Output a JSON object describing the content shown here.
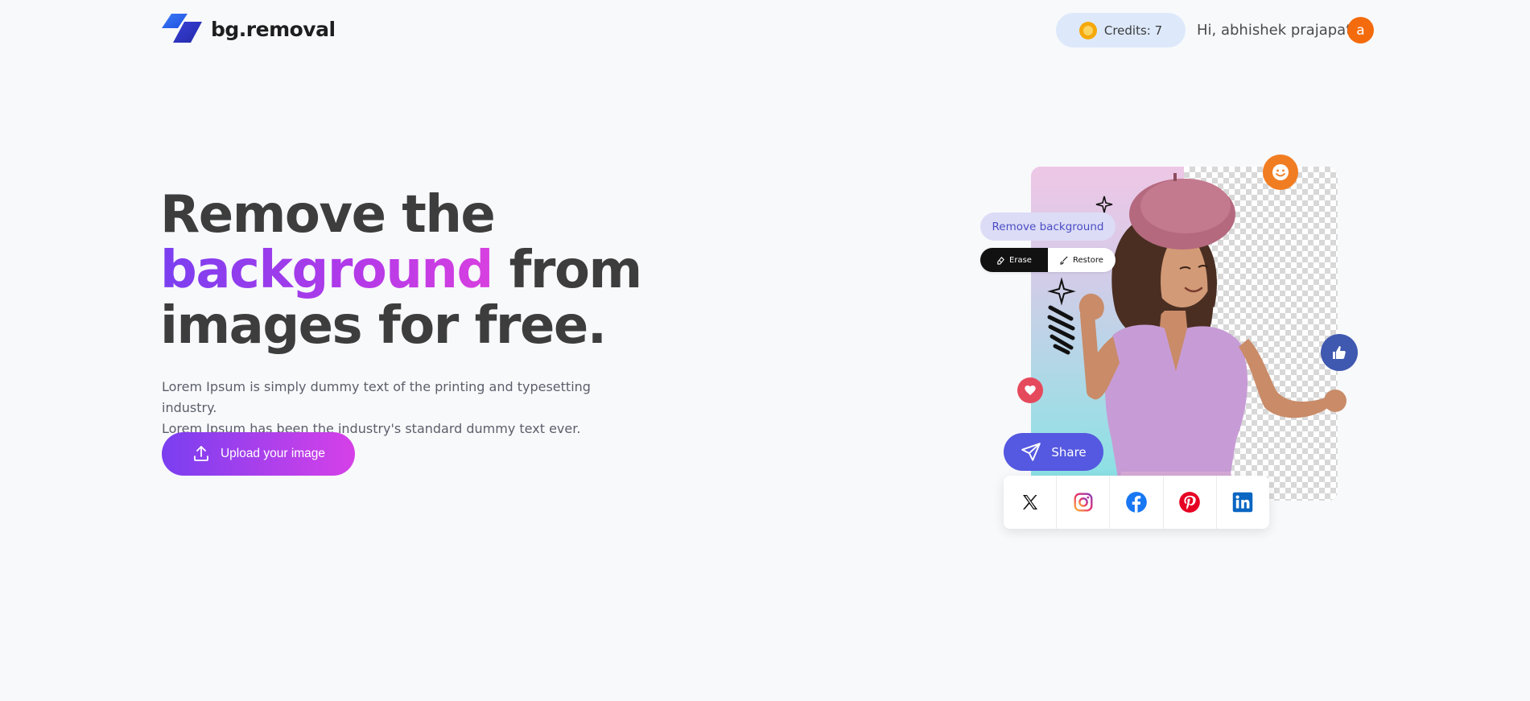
{
  "nav": {
    "brand": "bg.removal",
    "credits_label": "Credits: 7",
    "greeting": "Hi, abhishek prajapati",
    "avatar_initial": "a"
  },
  "hero": {
    "headline_line1": "Remove the",
    "headline_highlight": "background",
    "headline_line2_rest": " from",
    "headline_line3": "images for free.",
    "description_line1": "Lorem Ipsum is simply dummy text of the printing and typesetting industry.",
    "description_line2": "Lorem Ipsum has been the industry's standard dummy text ever.",
    "upload_label": "Upload your image"
  },
  "illustration": {
    "remove_bg_label": "Remove background",
    "erase_label": "Erase",
    "restore_label": "Restore",
    "share_label": "Share",
    "social_icons": [
      "x-icon",
      "instagram-icon",
      "facebook-icon",
      "pinterest-icon",
      "linkedin-icon"
    ]
  },
  "colors": {
    "accent_purple": "#7a3ff0",
    "accent_pink": "#d640e8",
    "credits_bg": "#dde9fb",
    "avatar_bg": "#f36b0c",
    "share_bg": "#5558e0"
  }
}
